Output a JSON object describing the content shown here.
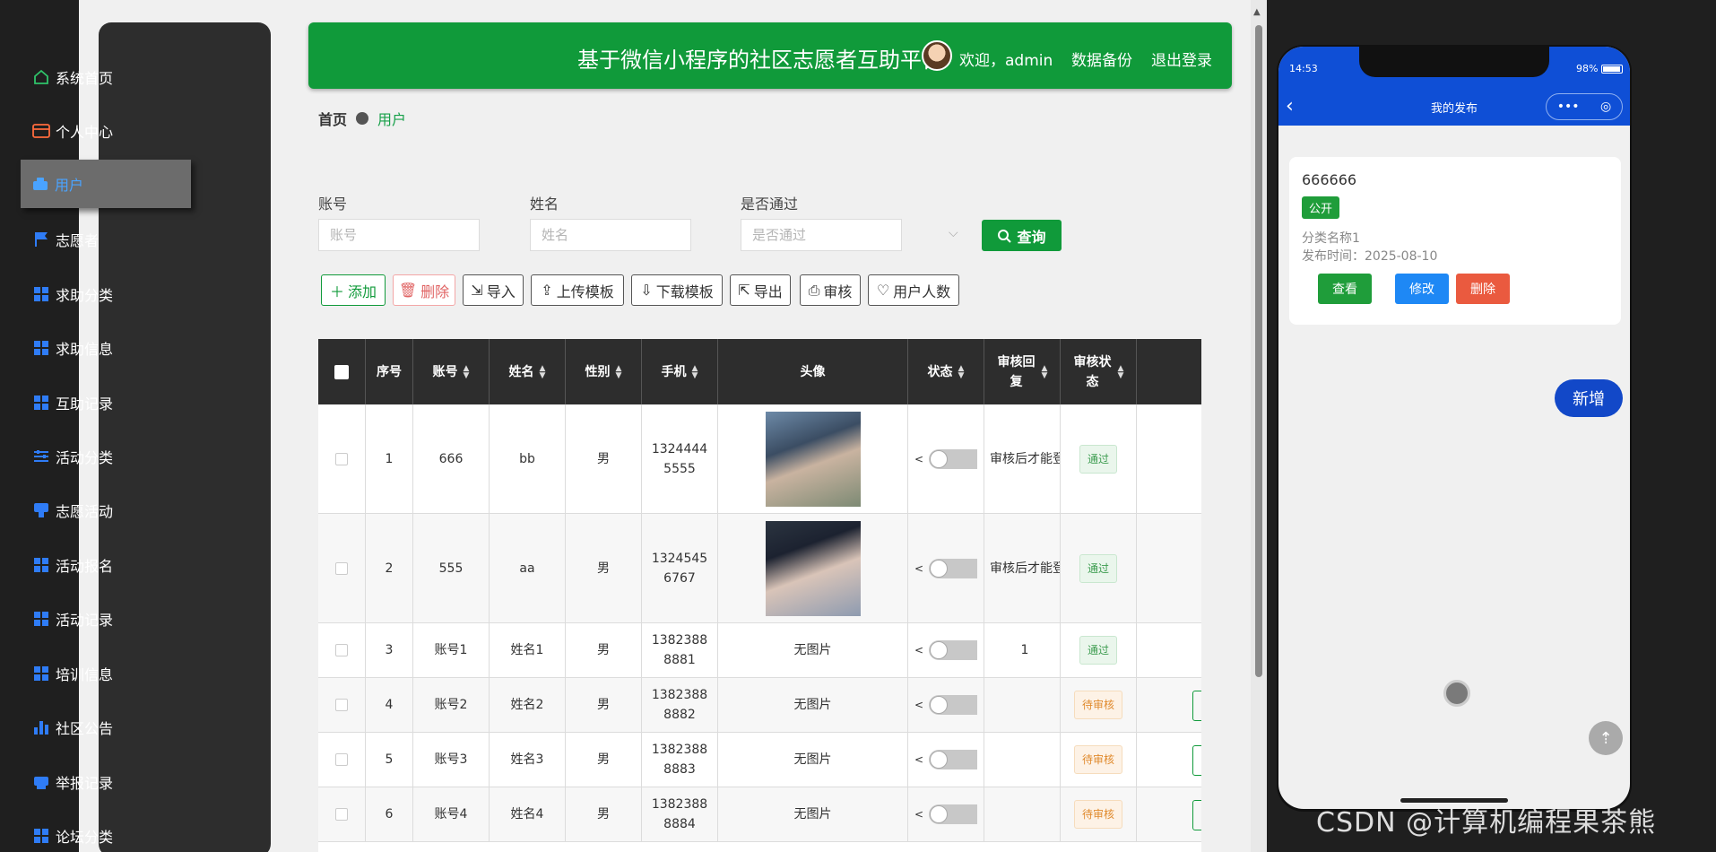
{
  "header": {
    "title": "基于微信小程序的社区志愿者互助平台",
    "welcome": "欢迎，admin",
    "backup": "数据备份",
    "logout": "退出登录"
  },
  "sidebar": {
    "items": [
      {
        "label": "系统首页",
        "icon": "home-icon"
      },
      {
        "label": "个人中心",
        "icon": "wallet-icon"
      },
      {
        "label": "用户",
        "icon": "users-icon"
      },
      {
        "label": "志愿者",
        "icon": "flag-icon"
      },
      {
        "label": "求助分类",
        "icon": "grid-icon"
      },
      {
        "label": "求助信息",
        "icon": "grid-icon"
      },
      {
        "label": "互助记录",
        "icon": "grid-icon"
      },
      {
        "label": "活动分类",
        "icon": "sliders-icon"
      },
      {
        "label": "志愿活动",
        "icon": "tag-icon"
      },
      {
        "label": "活动报名",
        "icon": "grid-icon"
      },
      {
        "label": "活动记录",
        "icon": "grid-icon"
      },
      {
        "label": "培训信息",
        "icon": "grid-icon"
      },
      {
        "label": "社区公告",
        "icon": "bar-chart-icon"
      },
      {
        "label": "举报记录",
        "icon": "printer-icon"
      },
      {
        "label": "论坛分类",
        "icon": "grid-icon"
      }
    ],
    "active_index": 2
  },
  "breadcrumb": {
    "home": "首页",
    "current": "用户"
  },
  "search": {
    "account_label": "账号",
    "account_placeholder": "账号",
    "name_label": "姓名",
    "name_placeholder": "姓名",
    "passed_label": "是否通过",
    "passed_placeholder": "是否通过",
    "query_label": "查询"
  },
  "actions": {
    "add": "添加",
    "delete": "删除",
    "import": "导入",
    "upload_template": "上传模板",
    "download_template": "下载模板",
    "export": "导出",
    "audit": "审核",
    "user_count": "用户人数"
  },
  "table": {
    "columns": [
      "序号",
      "账号",
      "姓名",
      "性别",
      "手机",
      "头像",
      "状态",
      "审核回复",
      "审核状态"
    ],
    "rows": [
      {
        "index": "1",
        "account": "666",
        "name": "bb",
        "gender": "男",
        "phone": "13244445555",
        "avatar": "photo",
        "reply": "审核后才能登",
        "status": "通过",
        "status_type": "pass"
      },
      {
        "index": "2",
        "account": "555",
        "name": "aa",
        "gender": "男",
        "phone": "13245456767",
        "avatar": "photo",
        "reply": "审核后才能登",
        "status": "通过",
        "status_type": "pass"
      },
      {
        "index": "3",
        "account": "账号1",
        "name": "姓名1",
        "gender": "男",
        "phone": "13823888881",
        "avatar": "无图片",
        "reply": "1",
        "status": "通过",
        "status_type": "pass"
      },
      {
        "index": "4",
        "account": "账号2",
        "name": "姓名2",
        "gender": "男",
        "phone": "13823888882",
        "avatar": "无图片",
        "reply": "",
        "status": "待审核",
        "status_type": "pending"
      },
      {
        "index": "5",
        "account": "账号3",
        "name": "姓名3",
        "gender": "男",
        "phone": "13823888883",
        "avatar": "无图片",
        "reply": "",
        "status": "待审核",
        "status_type": "pending"
      },
      {
        "index": "6",
        "account": "账号4",
        "name": "姓名4",
        "gender": "男",
        "phone": "13823888884",
        "avatar": "无图片",
        "reply": "",
        "status": "待审核",
        "status_type": "pending"
      }
    ]
  },
  "phone": {
    "time": "14:53",
    "battery": "98%",
    "page_title": "我的发布",
    "card": {
      "title": "666666",
      "badge": "公开",
      "category": "分类名称1",
      "publish_time": "发布时间：2025-08-10",
      "view": "查看",
      "edit": "修改",
      "delete": "删除"
    },
    "new_button": "新增"
  },
  "watermark": "CSDN @计算机编程果茶熊",
  "colors": {
    "primary_green": "#109a3a",
    "sidebar_bg": "#2d2d2d",
    "phone_blue": "#0f4fd6"
  }
}
